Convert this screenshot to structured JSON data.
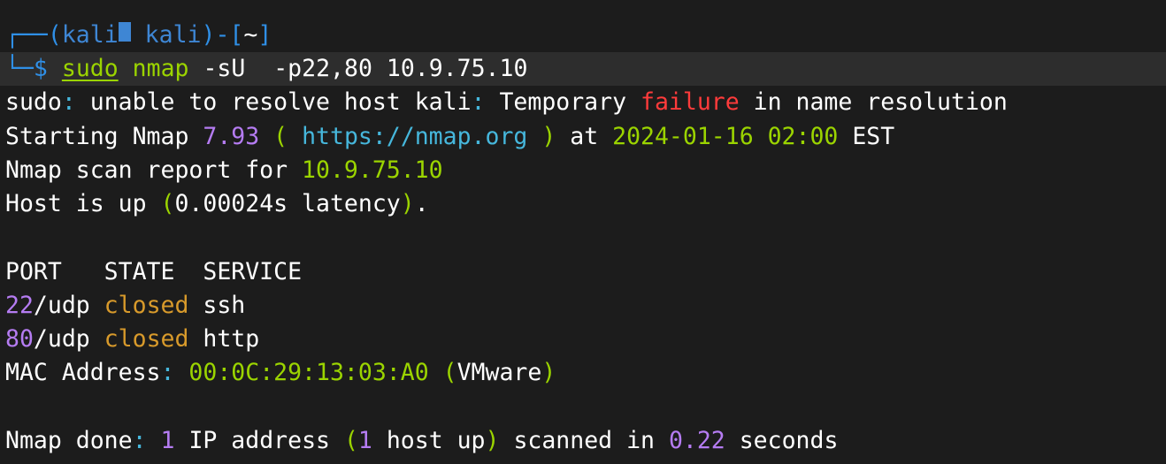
{
  "prompt": {
    "corner_top": "┌──",
    "open_paren": "(",
    "user": "kali",
    "host": "kali",
    "close_paren": ")-[",
    "dir": "~",
    "close_bracket": "]",
    "corner_bottom": "└─",
    "dollar": "$",
    "cmd_sudo": "sudo",
    "cmd_nmap": "nmap",
    "cmd_args": "-sU  -p22,80",
    "cmd_target": "10.9.75.10"
  },
  "output": {
    "line1": {
      "a": "sudo",
      "b": ":",
      "c": " unable to resolve host kali",
      "d": ":",
      "e": " Temporary ",
      "f": "failure",
      "g": " in name resolution"
    },
    "line2": {
      "a": "Starting Nmap ",
      "b": "7.93",
      "c": " ( ",
      "d": "https://nmap.org",
      "e": " ) ",
      "f": "at ",
      "g": "2024-01-16 02:00",
      "h": " EST"
    },
    "line3": {
      "a": "Nmap scan report for ",
      "b": "10.9.75.10"
    },
    "line4": {
      "a": "Host is up ",
      "b": "(",
      "c": "0.00024s latency",
      "d": ")",
      "e": "."
    },
    "table_header": "PORT   STATE  SERVICE",
    "rows": [
      {
        "port": "22",
        "proto": "/udp ",
        "state": "closed",
        "service": " ssh"
      },
      {
        "port": "80",
        "proto": "/udp ",
        "state": "closed",
        "service": " http"
      }
    ],
    "mac": {
      "a": "MAC Address",
      "b": ": ",
      "c": "00:0C:29:13:03:A0",
      "d": " (",
      "e": "VMware",
      "f": ")"
    },
    "done": {
      "a": "Nmap done",
      "b": ": ",
      "c": "1",
      "d": " IP address ",
      "e": "(",
      "f": "1",
      "g": " host up",
      "h": ")",
      "i": " scanned in ",
      "j": "0.22",
      "k": " seconds"
    }
  },
  "colors": {
    "background": "#1c1c1c",
    "prompt_line_bg": "#2d2d2d",
    "frame_blue": "#2f8fe6",
    "user_blue": "#3e86d4",
    "green": "#9bd400",
    "cyan": "#46b7dc",
    "red": "#ff3b3b",
    "orange": "#d89a2b",
    "purple": "#b57cf2"
  }
}
